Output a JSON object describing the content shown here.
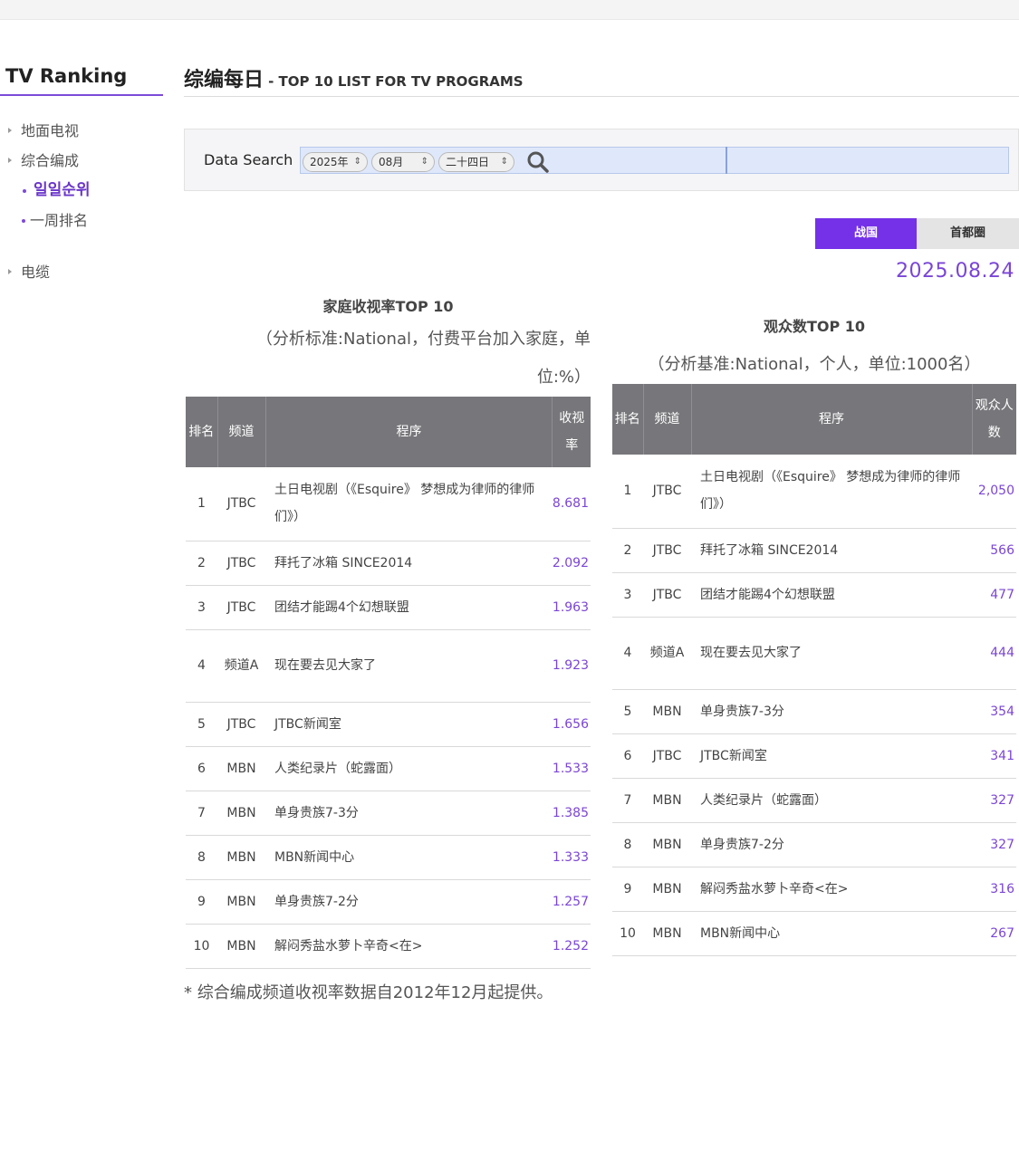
{
  "sidebar": {
    "title": "TV Ranking",
    "menu": [
      {
        "label": "地面电视"
      },
      {
        "label": "综合编成"
      }
    ],
    "submenu": [
      {
        "label": "일일순위",
        "active": true
      },
      {
        "label": "一周排名",
        "active": false
      }
    ],
    "menu_bottom": {
      "label": "电缆"
    }
  },
  "header": {
    "title": "综编每日",
    "subtitle": "- TOP 10 LIST FOR TV PROGRAMS"
  },
  "search": {
    "label": "Data Search",
    "year": "2025年",
    "month": "08月",
    "day": "二十四日",
    "search_icon": "search-icon"
  },
  "tabs": {
    "national": "战国",
    "capital": "首都圈",
    "active": "national"
  },
  "date": "2025.08.24",
  "household": {
    "title": "家庭收视率TOP 10",
    "note": "（分析标准:National，付费平台加入家庭，单位:%）",
    "headers": [
      "排名",
      "频道",
      "程序",
      "收视率"
    ],
    "rows": [
      {
        "rank": "1",
        "channel": "JTBC",
        "program": "土日电视剧（《Esquire》 梦想成为律师的律师们》）",
        "value": "8.681"
      },
      {
        "rank": "2",
        "channel": "JTBC",
        "program": "拜托了冰箱 SINCE2014",
        "value": "2.092"
      },
      {
        "rank": "3",
        "channel": "JTBC",
        "program": "团结才能踢4个幻想联盟",
        "value": "1.963"
      },
      {
        "rank": "4",
        "channel": "频道A",
        "program": "现在要去见大家了",
        "value": "1.923"
      },
      {
        "rank": "5",
        "channel": "JTBC",
        "program": "JTBC新闻室",
        "value": "1.656"
      },
      {
        "rank": "6",
        "channel": "MBN",
        "program": "人类纪录片（蛇露面）",
        "value": "1.533"
      },
      {
        "rank": "7",
        "channel": "MBN",
        "program": "单身贵族7-3分",
        "value": "1.385"
      },
      {
        "rank": "8",
        "channel": "MBN",
        "program": "MBN新闻中心",
        "value": "1.333"
      },
      {
        "rank": "9",
        "channel": "MBN",
        "program": "单身贵族7-2分",
        "value": "1.257"
      },
      {
        "rank": "10",
        "channel": "MBN",
        "program": "解闷秀盐水萝卜辛奇<在>",
        "value": "1.252"
      }
    ]
  },
  "viewers": {
    "title": "观众数TOP 10",
    "note": "（分析基准:National，个人，单位:1000名）",
    "headers": [
      "排名",
      "频道",
      "程序",
      "观众人数"
    ],
    "rows": [
      {
        "rank": "1",
        "channel": "JTBC",
        "program": "土日电视剧（《Esquire》 梦想成为律师的律师们》）",
        "value": "2,050"
      },
      {
        "rank": "2",
        "channel": "JTBC",
        "program": "拜托了冰箱 SINCE2014",
        "value": "566"
      },
      {
        "rank": "3",
        "channel": "JTBC",
        "program": "团结才能踢4个幻想联盟",
        "value": "477"
      },
      {
        "rank": "4",
        "channel": "频道A",
        "program": "现在要去见大家了",
        "value": "444"
      },
      {
        "rank": "5",
        "channel": "MBN",
        "program": "单身贵族7-3分",
        "value": "354"
      },
      {
        "rank": "6",
        "channel": "JTBC",
        "program": "JTBC新闻室",
        "value": "341"
      },
      {
        "rank": "7",
        "channel": "MBN",
        "program": "人类纪录片（蛇露面）",
        "value": "327"
      },
      {
        "rank": "8",
        "channel": "MBN",
        "program": "单身贵族7-2分",
        "value": "327"
      },
      {
        "rank": "9",
        "channel": "MBN",
        "program": "解闷秀盐水萝卜辛奇<在>",
        "value": "316"
      },
      {
        "rank": "10",
        "channel": "MBN",
        "program": "MBN新闻中心",
        "value": "267"
      }
    ]
  },
  "footnote": "* 综合编成频道收视率数据自2012年12月起提供。",
  "colors": {
    "accent": "#7431e8",
    "value_text": "#7a45d6",
    "table_header": "#77777b"
  }
}
